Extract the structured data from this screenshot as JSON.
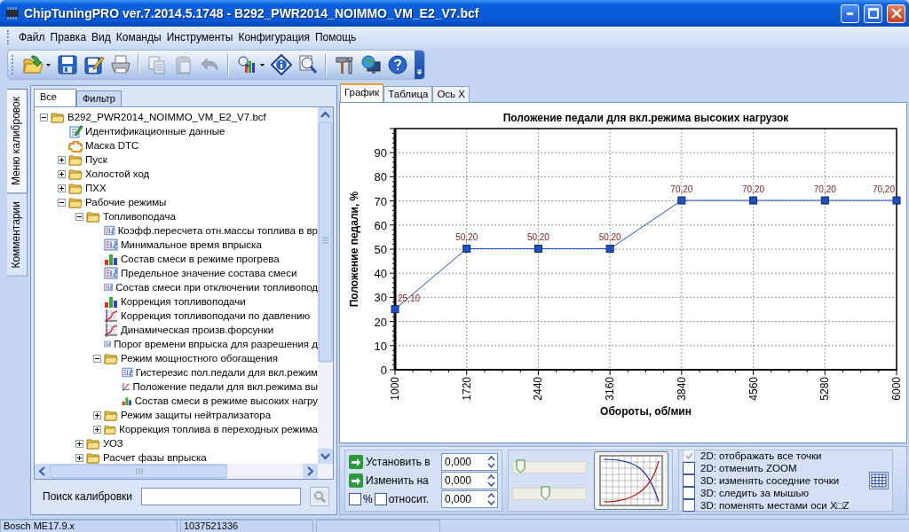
{
  "window": {
    "title": "ChipTuningPRO ver.7.2014.5.1748 - B292_PWR2014_NOIMMO_VM_E2_V7.bcf"
  },
  "menu": [
    "Файл",
    "Правка",
    "Вид",
    "Команды",
    "Инструменты",
    "Конфигурация",
    "Помощь"
  ],
  "toolbar": [
    {
      "kind": "open",
      "disabled": false,
      "dropdown": true
    },
    {
      "kind": "save",
      "disabled": false
    },
    {
      "kind": "save-edit",
      "disabled": false
    },
    {
      "kind": "print",
      "disabled": false
    },
    {
      "kind": "separator"
    },
    {
      "kind": "copy",
      "disabled": true
    },
    {
      "kind": "paste",
      "disabled": true
    },
    {
      "kind": "undo",
      "disabled": true
    },
    {
      "kind": "separator"
    },
    {
      "kind": "chart",
      "disabled": false,
      "dropdown": true
    },
    {
      "kind": "info",
      "disabled": false
    },
    {
      "kind": "zoom",
      "disabled": false
    },
    {
      "kind": "separator"
    },
    {
      "kind": "tools",
      "disabled": false
    },
    {
      "kind": "network",
      "disabled": false
    },
    {
      "kind": "help",
      "disabled": false
    }
  ],
  "side_tabs": [
    {
      "label": "Меню калибровок",
      "selected": true
    },
    {
      "label": "Комментарии",
      "selected": false
    }
  ],
  "panel_tabs": [
    {
      "label": "Все",
      "selected": true
    },
    {
      "label": "Фильтр",
      "selected": false
    }
  ],
  "tree": [
    {
      "label": "B292_PWR2014_NOIMMO_VM_E2_V7.bcf",
      "kind": "folder",
      "expanded": true,
      "children": [
        {
          "label": "Идентификационные данные",
          "kind": "edit"
        },
        {
          "label": "Маска DTC",
          "kind": "engine"
        },
        {
          "label": "Пуск",
          "kind": "folder",
          "expanded": false
        },
        {
          "label": "Холостой ход",
          "kind": "folder",
          "expanded": false
        },
        {
          "label": "ПХХ",
          "kind": "folder",
          "expanded": false
        },
        {
          "label": "Рабочие режимы",
          "kind": "folder",
          "expanded": true,
          "children": [
            {
              "label": "Топливоподача",
              "kind": "folder",
              "expanded": true,
              "children": [
                {
                  "label": "Коэфф.пересчета отн.массы топлива в вр",
                  "kind": "value"
                },
                {
                  "label": "Минимальное время впрыска",
                  "kind": "value"
                },
                {
                  "label": "Состав смеси в режиме прогрева",
                  "kind": "bars"
                },
                {
                  "label": "Предельное значение состава смеси",
                  "kind": "value"
                },
                {
                  "label": "Состав смеси при отключении топливопод",
                  "kind": "value"
                },
                {
                  "label": "Коррекция топливоподачи",
                  "kind": "bars"
                },
                {
                  "label": "Коррекция топливоподачи по давлению",
                  "kind": "curve"
                },
                {
                  "label": "Динамическая произв.форсунки",
                  "kind": "curve"
                },
                {
                  "label": "Порог времени впрыска для разрешения д",
                  "kind": "value"
                },
                {
                  "label": "Режим мощностного обогащения",
                  "kind": "folder",
                  "expanded": true,
                  "children": [
                    {
                      "label": "Гистерезис пол.педали для вкл.режим",
                      "kind": "value"
                    },
                    {
                      "label": "Положение педали для вкл.режима вы",
                      "kind": "curve"
                    },
                    {
                      "label": "Состав смеси в режиме высоких нагру",
                      "kind": "bars"
                    }
                  ]
                },
                {
                  "label": "Режим защиты нейтрализатора",
                  "kind": "folder",
                  "expanded": false
                },
                {
                  "label": "Коррекция топлива в переходных режима",
                  "kind": "folder",
                  "expanded": false
                }
              ]
            },
            {
              "label": "УОЗ",
              "kind": "folder",
              "expanded": false
            },
            {
              "label": "Расчет фазы впрыска",
              "kind": "folder",
              "expanded": false
            }
          ]
        }
      ]
    }
  ],
  "search": {
    "label": "Поиск калибровки"
  },
  "view_tabs": [
    {
      "label": "График",
      "selected": true
    },
    {
      "label": "Таблица",
      "selected": false
    },
    {
      "label": "Ось X",
      "selected": false
    }
  ],
  "chart_data": {
    "type": "line",
    "title": "Положение педали для вкл.режима высоких нагрузок",
    "xlabel": "Обороты, об/мин",
    "ylabel": "Положение педали, %",
    "categories": [
      "1000",
      "1720",
      "2440",
      "3160",
      "3840",
      "4560",
      "5280",
      "6000"
    ],
    "grid": true,
    "series": [
      {
        "color": "#1f4fc0",
        "marker": "square",
        "values": [
          25.1,
          50.2,
          50.2,
          50.2,
          70.2,
          70.2,
          70.2,
          70.2
        ]
      }
    ],
    "ylim": [
      0,
      100
    ],
    "yticks": [
      0,
      10,
      20,
      30,
      40,
      50,
      60,
      70,
      80,
      90
    ],
    "value_labels": [
      "25,10",
      "50,20",
      "50,20",
      "50,20",
      "70,20",
      "70,20",
      "70,20",
      "70,20"
    ]
  },
  "adjust": [
    {
      "kind": "apply",
      "label": "Установить в",
      "value": "0,000"
    },
    {
      "kind": "apply",
      "label": "Изменить на",
      "value": "0,000"
    },
    {
      "kind": "flags",
      "flags": [
        {
          "label": "%",
          "checked": false
        },
        {
          "label": "относит.",
          "checked": false
        }
      ],
      "value": "0,000"
    }
  ],
  "sliders": [
    {
      "level": 0.04
    },
    {
      "level": 0.44
    }
  ],
  "options": [
    {
      "label": "2D: отображать все точки",
      "checked": true,
      "disabled": true
    },
    {
      "label": "2D: отменить ZOOM",
      "checked": false,
      "disabled": false
    },
    {
      "label": "3D: изменять соседние точки",
      "checked": false,
      "disabled": false
    },
    {
      "label": "3D: следить за мышью",
      "checked": false,
      "disabled": false
    },
    {
      "label": "3D: поменять местами оси X□Z",
      "checked": false,
      "disabled": false
    }
  ],
  "status_bar": [
    "Bosch ME17.9.x",
    "1037521336"
  ]
}
